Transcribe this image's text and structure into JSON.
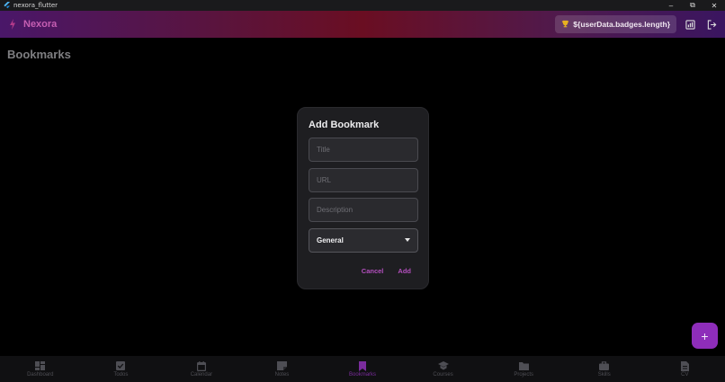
{
  "window": {
    "title": "nexora_flutter",
    "minimize": "–",
    "restore": "⧉",
    "close": "✕"
  },
  "appbar": {
    "brand": "Nexora",
    "badge_text": "${userData.badges.length}",
    "brand_color": "#c55eb2"
  },
  "page": {
    "title": "Bookmarks"
  },
  "dialog": {
    "title": "Add Bookmark",
    "title_placeholder": "Title",
    "url_placeholder": "URL",
    "description_placeholder": "Description",
    "category_selected": "General",
    "cancel_label": "Cancel",
    "add_label": "Add"
  },
  "fab": {
    "label": "+"
  },
  "nav": {
    "items": [
      {
        "label": "Dashboard",
        "icon": "dashboard-icon"
      },
      {
        "label": "Todos",
        "icon": "checkbox-icon"
      },
      {
        "label": "Calendar",
        "icon": "calendar-icon"
      },
      {
        "label": "Notes",
        "icon": "note-icon"
      },
      {
        "label": "Bookmarks",
        "icon": "bookmark-icon"
      },
      {
        "label": "Courses",
        "icon": "school-icon"
      },
      {
        "label": "Projects",
        "icon": "folder-icon"
      },
      {
        "label": "Skills",
        "icon": "briefcase-icon"
      },
      {
        "label": "CV",
        "icon": "document-icon"
      }
    ],
    "active_color": "#7a2c9c",
    "inactive_color": "#4e4e54"
  }
}
